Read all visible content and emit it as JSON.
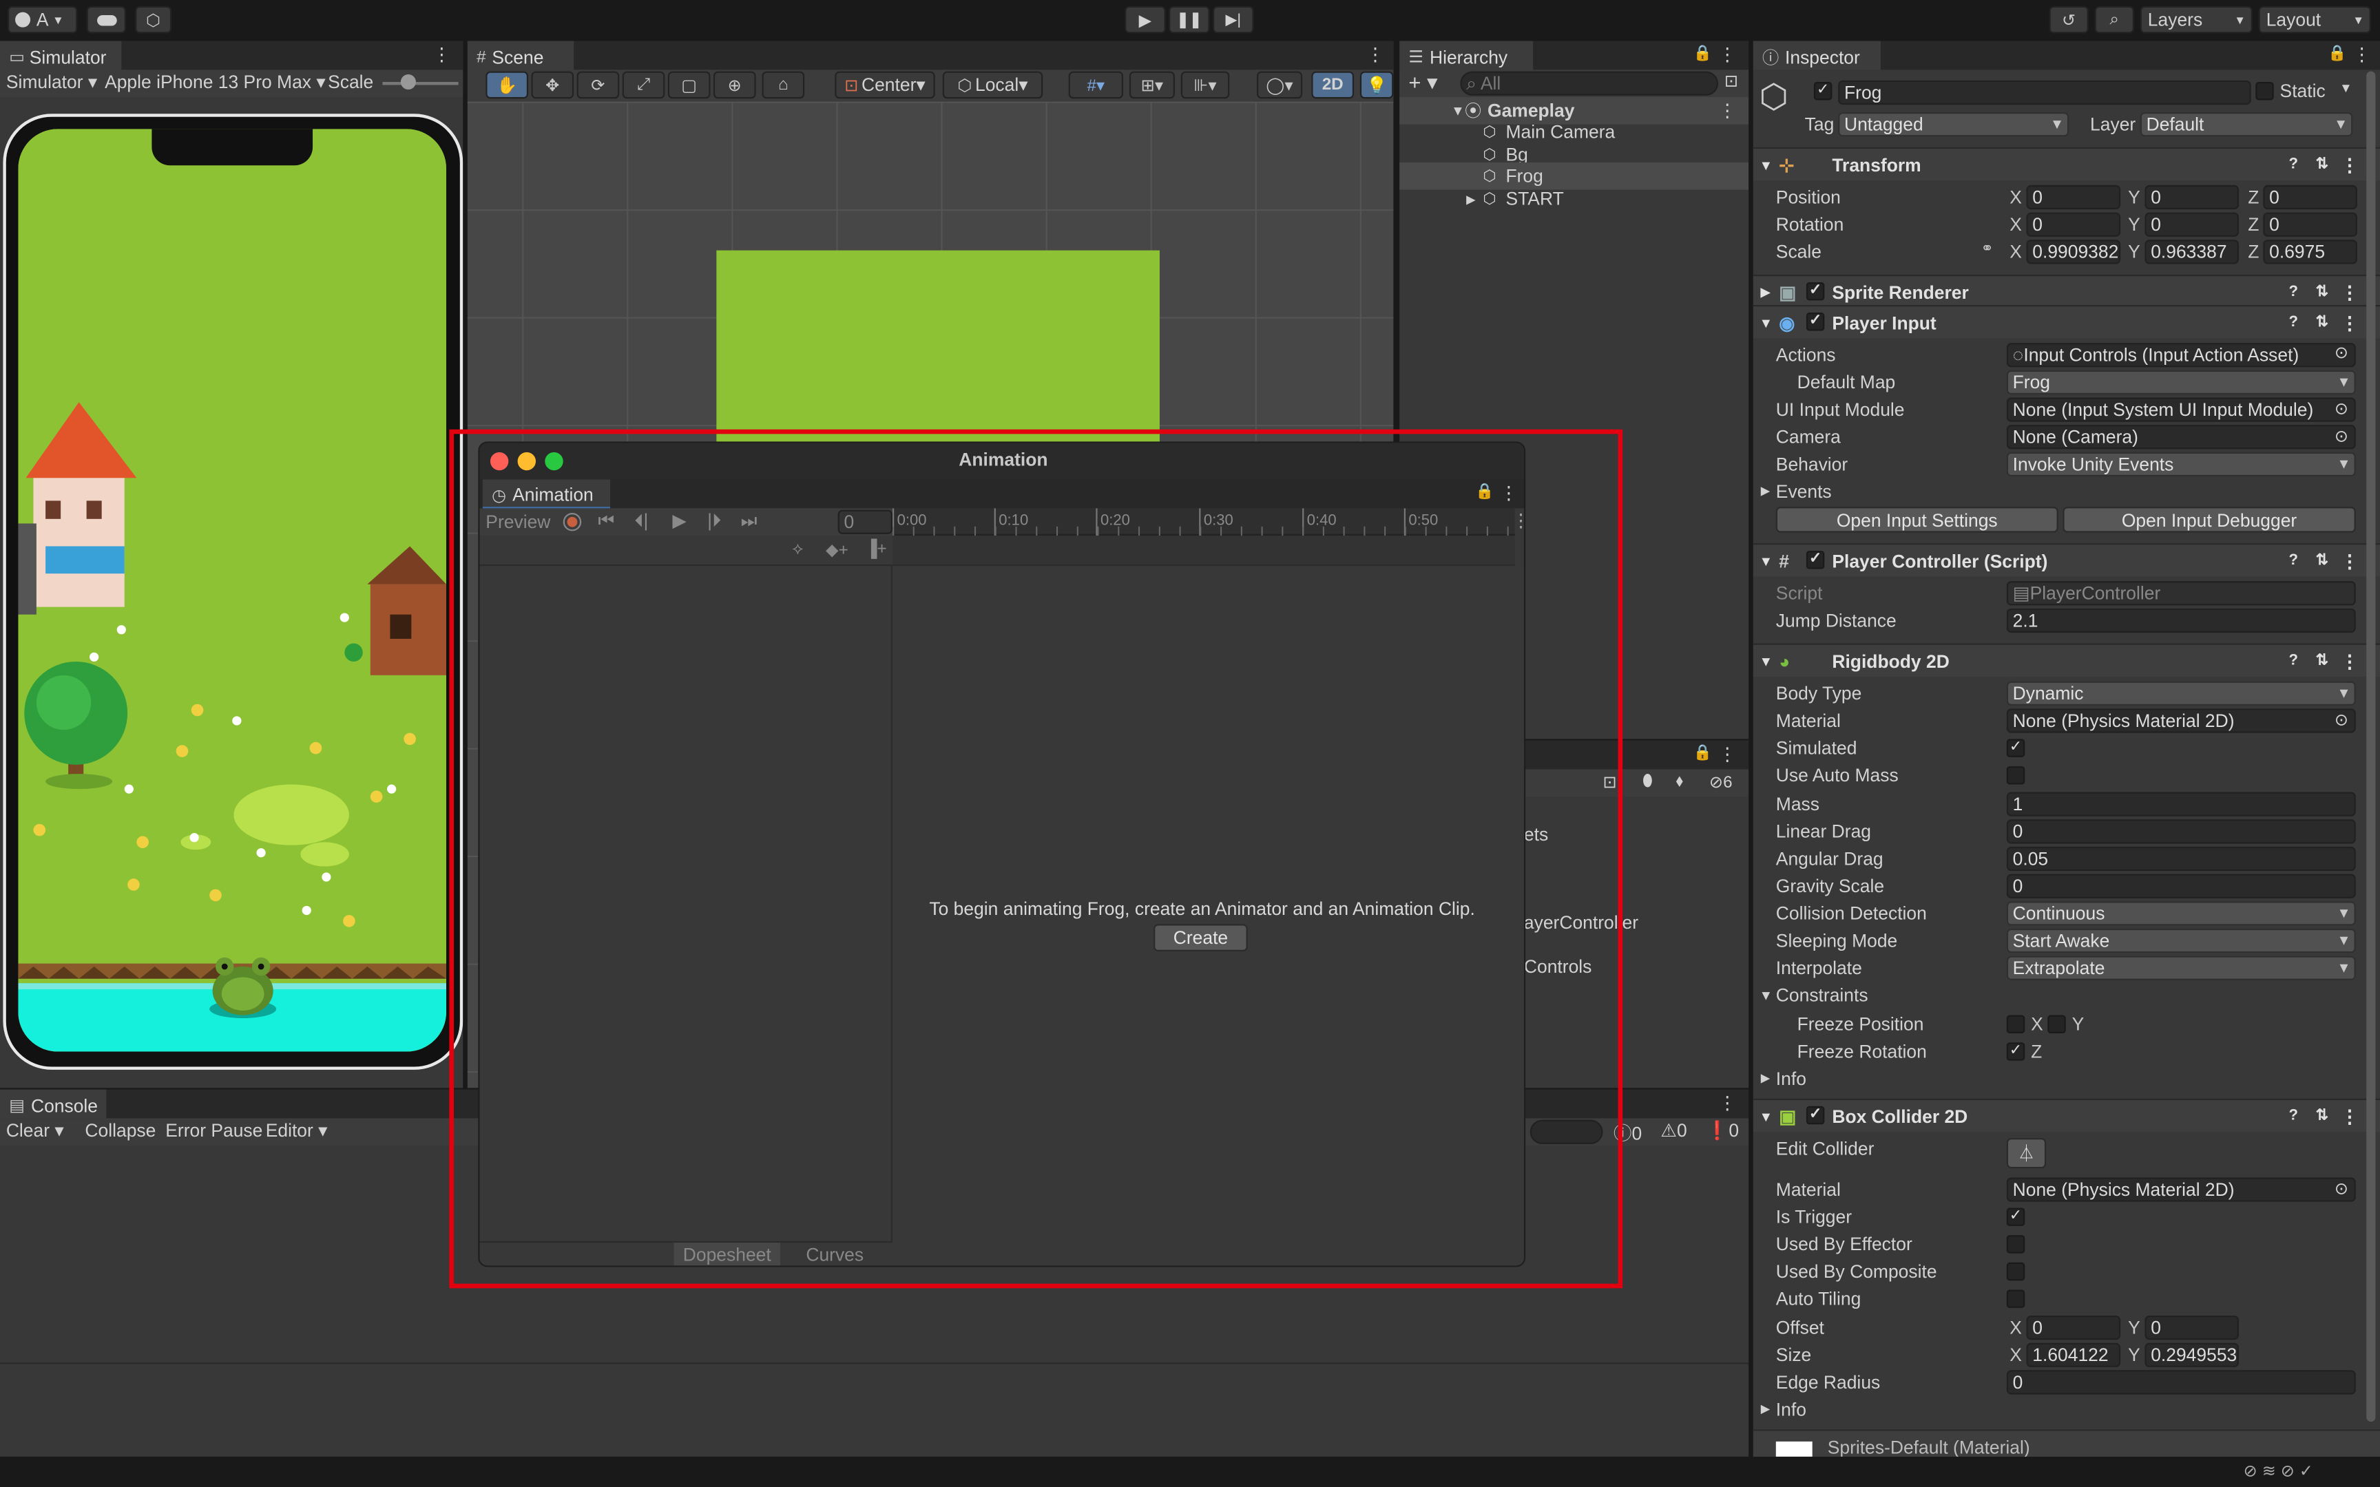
{
  "toolbar": {
    "account": "A",
    "layers": "Layers",
    "layout": "Layout"
  },
  "simulator": {
    "tab": "Simulator",
    "mode": "Simulator",
    "device": "Apple iPhone 13 Pro Max",
    "scale": "Scale"
  },
  "scene": {
    "tab": "Scene",
    "pivot": "Center",
    "space": "Local",
    "two_d": "2D"
  },
  "hierarchy": {
    "tab": "Hierarchy",
    "search_placeholder": "All",
    "root": "Gameplay",
    "items": [
      "Main Camera",
      "Bg",
      "Frog",
      "START"
    ]
  },
  "console": {
    "tab": "Console",
    "clear": "Clear",
    "collapse": "Collapse",
    "error_pause": "Error Pause",
    "editor": "Editor",
    "counts": [
      "0",
      "0",
      "0"
    ]
  },
  "project_fragments": {
    "count": "6",
    "f1": "ets",
    "f2": "ayerController",
    "f3": "Controls"
  },
  "animation": {
    "window_title": "Animation",
    "tab": "Animation",
    "preview": "Preview",
    "frame": "0",
    "ticks": [
      "0:00",
      "0:10",
      "0:20",
      "0:30",
      "0:40",
      "0:50"
    ],
    "message": "To begin animating Frog, create an Animator and an Animation Clip.",
    "create": "Create",
    "dopesheet": "Dopesheet",
    "curves": "Curves"
  },
  "inspector": {
    "tab": "Inspector",
    "object_name": "Frog",
    "static": "Static",
    "tag_label": "Tag",
    "tag_value": "Untagged",
    "layer_label": "Layer",
    "layer_value": "Default",
    "transform": {
      "title": "Transform",
      "position_label": "Position",
      "rotation_label": "Rotation",
      "scale_label": "Scale",
      "position": [
        "0",
        "0",
        "0"
      ],
      "rotation": [
        "0",
        "0",
        "0"
      ],
      "scale": [
        "0.9909382",
        "0.963387",
        "0.6975"
      ]
    },
    "sprite_renderer": {
      "title": "Sprite Renderer"
    },
    "player_input": {
      "title": "Player Input",
      "actions_label": "Actions",
      "actions": "Input Controls (Input Action Asset)",
      "default_map_label": "Default Map",
      "default_map": "Frog",
      "ui_module_label": "UI Input Module",
      "ui_module": "None (Input System UI Input Module)",
      "camera_label": "Camera",
      "camera": "None (Camera)",
      "behavior_label": "Behavior",
      "behavior": "Invoke Unity Events",
      "events": "Events",
      "open_settings": "Open Input Settings",
      "open_debugger": "Open Input Debugger"
    },
    "player_controller": {
      "title": "Player Controller (Script)",
      "script_label": "Script",
      "script": "PlayerController",
      "jump_label": "Jump Distance",
      "jump": "2.1"
    },
    "rigidbody": {
      "title": "Rigidbody 2D",
      "body_type_label": "Body Type",
      "body_type": "Dynamic",
      "material_label": "Material",
      "material": "None (Physics Material 2D)",
      "simulated_label": "Simulated",
      "use_auto_mass_label": "Use Auto Mass",
      "mass_label": "Mass",
      "mass": "1",
      "linear_drag_label": "Linear Drag",
      "linear_drag": "0",
      "angular_drag_label": "Angular Drag",
      "angular_drag": "0.05",
      "gravity_label": "Gravity Scale",
      "gravity": "0",
      "collision_label": "Collision Detection",
      "collision": "Continuous",
      "sleeping_label": "Sleeping Mode",
      "sleeping": "Start Awake",
      "interpolate_label": "Interpolate",
      "interpolate": "Extrapolate",
      "constraints": "Constraints",
      "freeze_pos_label": "Freeze Position",
      "freeze_rot_label": "Freeze Rotation",
      "info": "Info",
      "x": "X",
      "y": "Y",
      "z": "Z"
    },
    "box_collider": {
      "title": "Box Collider 2D",
      "edit_label": "Edit Collider",
      "material_label": "Material",
      "material": "None (Physics Material 2D)",
      "is_trigger_label": "Is Trigger",
      "used_by_effector_label": "Used By Effector",
      "used_by_composite_label": "Used By Composite",
      "auto_tiling_label": "Auto Tiling",
      "offset_label": "Offset",
      "offset": [
        "0",
        "0"
      ],
      "size_label": "Size",
      "size": [
        "1.604122",
        "0.2949553"
      ],
      "edge_label": "Edge Radius",
      "edge": "0",
      "info": "Info"
    },
    "material_footer": "Sprites-Default (Material)"
  }
}
